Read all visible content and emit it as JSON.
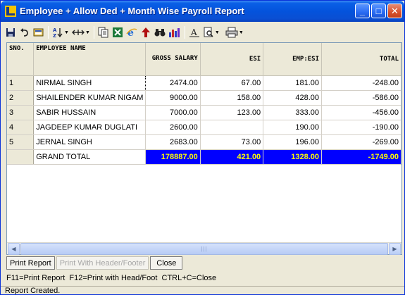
{
  "window": {
    "title": "Employee + Allow Ded + Month Wise Payroll Report",
    "buttons": {
      "minimize": "_",
      "maximize": "□",
      "close": "✕"
    }
  },
  "toolbar": {
    "icons": [
      "save-icon",
      "undo-icon",
      "refresh-icon",
      "sort-az-icon",
      "column-width-icon",
      "copy-icon",
      "excel-icon",
      "internet-explorer-icon",
      "up-arrow-icon",
      "binoculars-find-icon",
      "chart-icon",
      "font-icon",
      "print-preview-icon",
      "printer-icon"
    ]
  },
  "grid": {
    "columns": [
      {
        "label": "SNO."
      },
      {
        "label": "EMPLOYEE NAME"
      },
      {
        "label": "GROSS SALARY"
      },
      {
        "label": "ESI"
      },
      {
        "label": "EMP:ESI"
      },
      {
        "label": "TOTAL"
      }
    ],
    "rows": [
      {
        "sno": "1",
        "name": "NIRMAL SINGH",
        "gross": "2474.00",
        "esi": "67.00",
        "emp_esi": "181.00",
        "total": "-248.00"
      },
      {
        "sno": "2",
        "name": "SHAILENDER KUMAR NIGAM",
        "gross": "9000.00",
        "esi": "158.00",
        "emp_esi": "428.00",
        "total": "-586.00"
      },
      {
        "sno": "3",
        "name": "SABIR HUSSAIN",
        "gross": "7000.00",
        "esi": "123.00",
        "emp_esi": "333.00",
        "total": "-456.00"
      },
      {
        "sno": "4",
        "name": "JAGDEEP KUMAR DUGLATI",
        "gross": "2600.00",
        "esi": "",
        "emp_esi": "190.00",
        "total": "-190.00"
      },
      {
        "sno": "5",
        "name": "JERNAL SINGH",
        "gross": "2683.00",
        "esi": "73.00",
        "emp_esi": "196.00",
        "total": "-269.00"
      }
    ],
    "total_row": {
      "name": "GRAND TOTAL",
      "gross": "178887.00",
      "esi": "421.00",
      "emp_esi": "1328.00",
      "total": "-1749.00"
    },
    "highlight_color": "#0000ff",
    "highlight_text_color": "#ffff00"
  },
  "buttons": {
    "print_report": "Print Report",
    "print_header_footer": "Print With Header/Footer",
    "close": "Close"
  },
  "hint": "F11=Print Report  F12=Print with Head/Foot  CTRL+C=Close",
  "status": "Report Created."
}
